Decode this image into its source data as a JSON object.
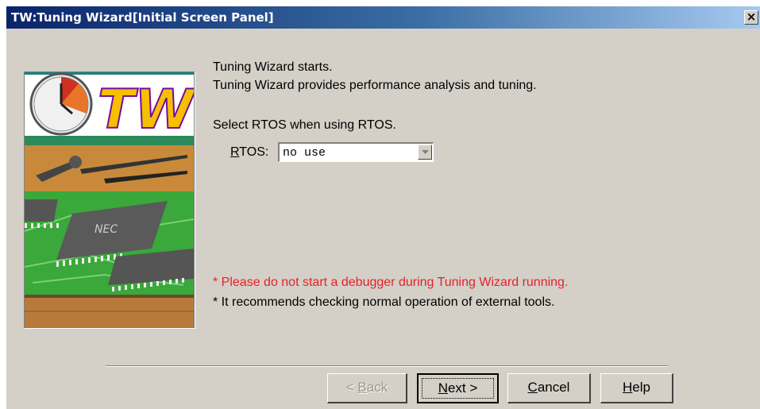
{
  "window": {
    "title": "TW:Tuning Wizard[Initial Screen Panel]",
    "close_glyph": "×"
  },
  "intro": {
    "line1": "Tuning Wizard starts.",
    "line2": "Tuning Wizard provides performance analysis and tuning.",
    "select_prompt": "Select RTOS when using RTOS."
  },
  "rtos": {
    "label": "RTOS:",
    "mnemonic": "R",
    "label_rest": "TOS:",
    "value": "no use"
  },
  "notes": {
    "warning": "* Please do not start a debugger during Tuning Wizard running.",
    "info": "* It recommends checking normal operation of external tools."
  },
  "image": {
    "logo_text": "TW",
    "chip_text": "NEC"
  },
  "buttons": {
    "back": {
      "label": "< Back",
      "prefix": "< ",
      "mnemonic": "B",
      "rest": "ack",
      "enabled": false
    },
    "next": {
      "label": "Next >",
      "mnemonic": "N",
      "rest": "ext >",
      "default": true
    },
    "cancel": {
      "label": "Cancel",
      "mnemonic": "C",
      "rest": "ancel"
    },
    "help": {
      "label": "Help",
      "mnemonic": "H",
      "rest": "elp"
    }
  },
  "colors": {
    "window_bg": "#d4d0c8",
    "title_start": "#0a246a",
    "title_end": "#a6caf0",
    "warning_text": "#e8202a"
  }
}
